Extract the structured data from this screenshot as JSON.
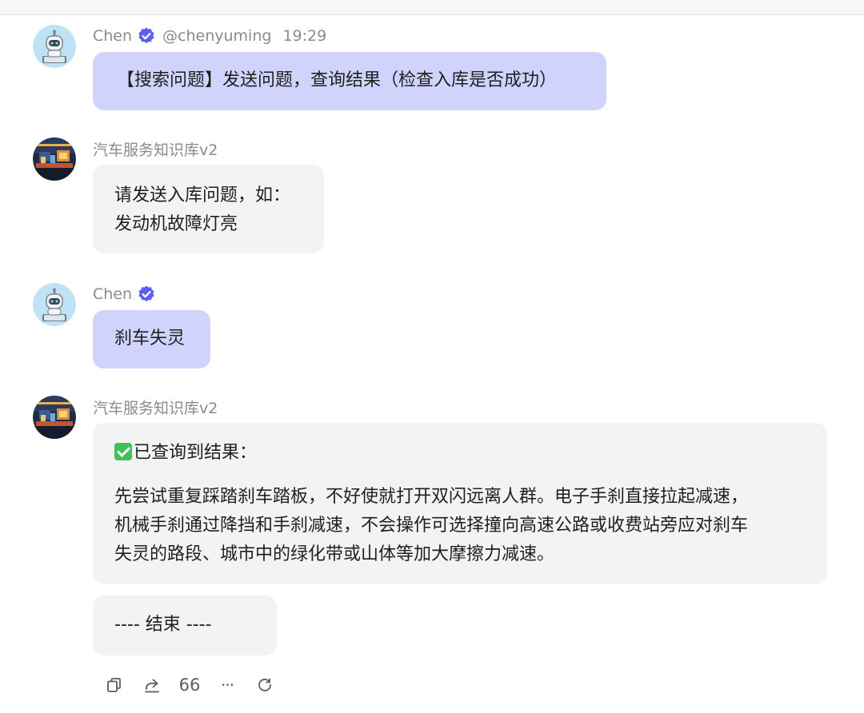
{
  "colors": {
    "user_bubble": "#d0d3fb",
    "bot_bubble": "#f3f3f3",
    "verified_badge": "#5b5ef0",
    "meta_text": "#8a8a8f"
  },
  "messages": [
    {
      "sender": "Chen",
      "handle": "@chenyuming",
      "time": "19:29",
      "verified": true,
      "avatar": "robot-avatar",
      "text": "【搜索问题】发送问题，查询结果（检查入库是否成功）"
    },
    {
      "sender": "汽车服务知识库v2",
      "avatar": "garage-avatar",
      "lines": [
        "请发送入库问题，如：",
        "发动机故障灯亮"
      ]
    },
    {
      "sender": "Chen",
      "verified": true,
      "avatar": "robot-avatar",
      "text": "刹车失灵"
    },
    {
      "sender": "汽车服务知识库v2",
      "avatar": "garage-avatar",
      "result_title": "已查询到结果：",
      "result_emoji": "check-mark-button",
      "result_lines": [
        "先尝试重复踩踏刹车踏板，不好使就打开双闪远离人群。电子手刹直接拉起减速，",
        "机械手刹通过降挡和手刹减速，不会操作可选择撞向高速公路或收费站旁应对刹车",
        "失灵的路段、城市中的绿化带或山体等加大摩擦力减速。"
      ],
      "end_text": "---- 结束 ----"
    }
  ],
  "actions": [
    {
      "name": "copy-icon",
      "label": ""
    },
    {
      "name": "share-icon",
      "label": ""
    },
    {
      "name": "quote-icon",
      "label": "66"
    },
    {
      "name": "more-icon",
      "label": "···"
    },
    {
      "name": "regenerate-icon",
      "label": ""
    }
  ]
}
